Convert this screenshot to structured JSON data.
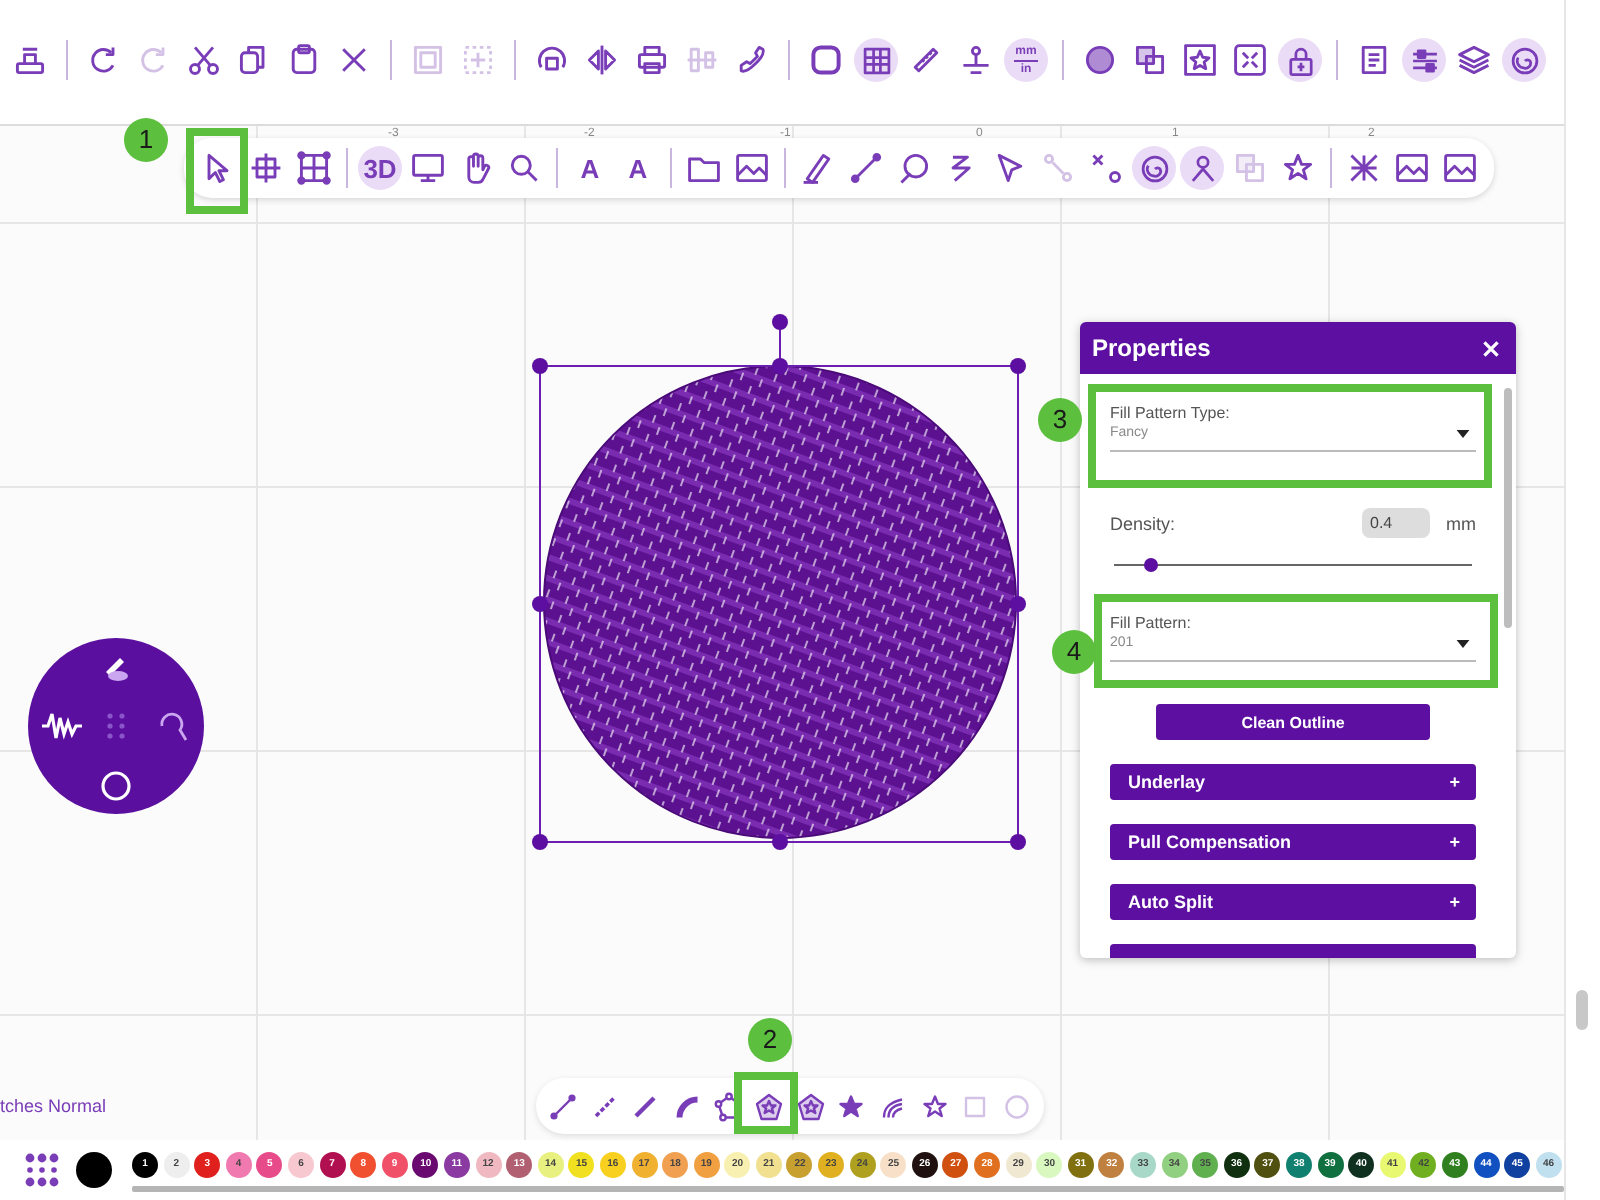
{
  "top_toolbar": [
    [
      {
        "kind": "stamp",
        "highlighted": false,
        "disabled": false
      }
    ],
    [
      {
        "kind": "redo",
        "highlighted": false,
        "disabled": false
      },
      {
        "kind": "redo",
        "highlighted": false,
        "disabled": true
      },
      {
        "kind": "scissors",
        "highlighted": false,
        "disabled": false
      },
      {
        "kind": "copy",
        "highlighted": false,
        "disabled": false
      },
      {
        "kind": "paste",
        "highlighted": false,
        "disabled": false
      },
      {
        "kind": "cross",
        "highlighted": false,
        "disabled": false
      }
    ],
    [
      {
        "kind": "frame",
        "highlighted": false,
        "disabled": true
      },
      {
        "kind": "dashedframe",
        "highlighted": false,
        "disabled": true
      }
    ],
    [
      {
        "kind": "rotate",
        "highlighted": false,
        "disabled": false
      },
      {
        "kind": "mirror",
        "highlighted": false,
        "disabled": false
      },
      {
        "kind": "printer",
        "highlighted": false,
        "disabled": false
      },
      {
        "kind": "align",
        "highlighted": false,
        "disabled": true
      },
      {
        "kind": "phone",
        "highlighted": false,
        "disabled": false
      }
    ],
    [
      {
        "kind": "roundsquare",
        "highlighted": false,
        "disabled": false
      },
      {
        "kind": "grid",
        "highlighted": true,
        "disabled": false
      },
      {
        "kind": "ruler",
        "highlighted": false,
        "disabled": false
      },
      {
        "kind": "pin",
        "highlighted": false,
        "disabled": false
      },
      {
        "kind": "units",
        "label": "mm",
        "sublabel": "in",
        "highlighted": true,
        "disabled": false
      }
    ],
    [
      {
        "kind": "circle",
        "highlighted": false,
        "disabled": false
      },
      {
        "kind": "overlap",
        "highlighted": false,
        "disabled": false
      },
      {
        "kind": "starframe",
        "highlighted": false,
        "disabled": false
      },
      {
        "kind": "expand",
        "highlighted": false,
        "disabled": false
      },
      {
        "kind": "lock",
        "highlighted": true,
        "disabled": false
      }
    ],
    [
      {
        "kind": "document",
        "highlighted": false,
        "disabled": false
      },
      {
        "kind": "sliders",
        "highlighted": true,
        "disabled": false
      },
      {
        "kind": "layers",
        "highlighted": false,
        "disabled": false
      },
      {
        "kind": "spiral",
        "highlighted": true,
        "disabled": false
      }
    ]
  ],
  "ruler_labels": [
    "-3",
    "-2",
    "-1",
    "0",
    "1",
    "2"
  ],
  "tool_toolbar": [
    [
      {
        "kind": "cursor",
        "highlighted": false,
        "disabled": false
      },
      {
        "kind": "crossframe",
        "highlighted": false,
        "disabled": false
      },
      {
        "kind": "gridframe",
        "highlighted": false,
        "disabled": false
      }
    ],
    [
      {
        "kind": "text",
        "label": "3D",
        "highlighted": true,
        "disabled": false
      },
      {
        "kind": "monitor",
        "highlighted": false,
        "disabled": false
      },
      {
        "kind": "hand",
        "highlighted": false,
        "disabled": false
      },
      {
        "kind": "search",
        "highlighted": false,
        "disabled": false
      }
    ],
    [
      {
        "kind": "text",
        "label": "A",
        "highlighted": false,
        "disabled": false
      },
      {
        "kind": "text",
        "label": "A",
        "highlighted": false,
        "disabled": false
      }
    ],
    [
      {
        "kind": "folder",
        "highlighted": false,
        "disabled": false
      },
      {
        "kind": "image",
        "highlighted": false,
        "disabled": false
      }
    ],
    [
      {
        "kind": "pen",
        "highlighted": false,
        "disabled": false
      },
      {
        "kind": "line",
        "highlighted": false,
        "disabled": false
      },
      {
        "kind": "circlepen",
        "highlighted": false,
        "disabled": false
      },
      {
        "kind": "zigzag",
        "highlighted": false,
        "disabled": false
      },
      {
        "kind": "pointer",
        "highlighted": false,
        "disabled": false
      },
      {
        "kind": "nodes",
        "highlighted": false,
        "disabled": true
      },
      {
        "kind": "crossnode",
        "highlighted": false,
        "disabled": false
      },
      {
        "kind": "spiral",
        "highlighted": true,
        "disabled": false
      },
      {
        "kind": "person",
        "highlighted": true,
        "disabled": false
      },
      {
        "kind": "overlap",
        "highlighted": false,
        "disabled": true
      },
      {
        "kind": "star",
        "highlighted": false,
        "disabled": false
      }
    ],
    [
      {
        "kind": "burst",
        "highlighted": false,
        "disabled": false
      },
      {
        "kind": "image",
        "highlighted": false,
        "disabled": false
      },
      {
        "kind": "image",
        "highlighted": false,
        "disabled": false
      }
    ]
  ],
  "properties": {
    "title": "Properties",
    "fill_pattern_type": {
      "label": "Fill Pattern Type:",
      "value": "Fancy"
    },
    "density": {
      "label": "Density:",
      "value": "0.4",
      "unit": "mm",
      "level": 0.1
    },
    "fill_pattern": {
      "label": "Fill Pattern:",
      "value": "201"
    },
    "clean_button": "Clean Outline",
    "sections": [
      {
        "title": "Underlay",
        "toggle": "+"
      },
      {
        "title": "Pull Compensation",
        "toggle": "+"
      },
      {
        "title": "Auto Split",
        "toggle": "+"
      }
    ],
    "more_sections_below": true
  },
  "status_text": "tches Normal",
  "shape_toolbar": [
    {
      "kind": "line",
      "disabled": false
    },
    {
      "kind": "dashline",
      "disabled": false
    },
    {
      "kind": "thickline",
      "disabled": false
    },
    {
      "kind": "arc",
      "disabled": false
    },
    {
      "kind": "nodeshape",
      "disabled": false
    },
    {
      "kind": "pentastar",
      "disabled": false
    },
    {
      "kind": "pentastar",
      "disabled": false
    },
    {
      "kind": "starfilled",
      "disabled": false
    },
    {
      "kind": "curves",
      "disabled": false
    },
    {
      "kind": "star",
      "disabled": false
    },
    {
      "kind": "square",
      "disabled": true
    },
    {
      "kind": "circleout",
      "disabled": true
    }
  ],
  "palette": {
    "current": {
      "color": "#000000"
    },
    "swatches": [
      {
        "label": "1",
        "color": "#000000"
      },
      {
        "label": "2",
        "color": "#eeeeee"
      },
      {
        "label": "3",
        "color": "#e0201c"
      },
      {
        "label": "4",
        "color": "#f07ab0"
      },
      {
        "label": "5",
        "color": "#e84b8a"
      },
      {
        "label": "6",
        "color": "#f8c8d0"
      },
      {
        "label": "7",
        "color": "#b01050"
      },
      {
        "label": "8",
        "color": "#f05030"
      },
      {
        "label": "9",
        "color": "#f05068"
      },
      {
        "label": "10",
        "color": "#6a0a70"
      },
      {
        "label": "11",
        "color": "#8a3aa0"
      },
      {
        "label": "12",
        "color": "#f0b8c0"
      },
      {
        "label": "13",
        "color": "#b06070"
      },
      {
        "label": "14",
        "color": "#e8f080"
      },
      {
        "label": "15",
        "color": "#f0e020"
      },
      {
        "label": "16",
        "color": "#f8d020"
      },
      {
        "label": "17",
        "color": "#f0b030"
      },
      {
        "label": "18",
        "color": "#f0a050"
      },
      {
        "label": "19",
        "color": "#f0a040"
      },
      {
        "label": "20",
        "color": "#f8f0b0"
      },
      {
        "label": "21",
        "color": "#f0e090"
      },
      {
        "label": "22",
        "color": "#c8a030"
      },
      {
        "label": "23",
        "color": "#e0b020"
      },
      {
        "label": "24",
        "color": "#b0a020"
      },
      {
        "label": "25",
        "color": "#f8e0c8"
      },
      {
        "label": "26",
        "color": "#201010"
      },
      {
        "label": "27",
        "color": "#d05010"
      },
      {
        "label": "28",
        "color": "#e07020"
      },
      {
        "label": "29",
        "color": "#f0e8d0"
      },
      {
        "label": "30",
        "color": "#d8f8c0"
      },
      {
        "label": "31",
        "color": "#807010"
      },
      {
        "label": "32",
        "color": "#c08040"
      },
      {
        "label": "33",
        "color": "#a8d8c8"
      },
      {
        "label": "34",
        "color": "#90d080"
      },
      {
        "label": "35",
        "color": "#60b050"
      },
      {
        "label": "36",
        "color": "#103010"
      },
      {
        "label": "37",
        "color": "#505010"
      },
      {
        "label": "38",
        "color": "#108070"
      },
      {
        "label": "39",
        "color": "#107040"
      },
      {
        "label": "40",
        "color": "#103020"
      },
      {
        "label": "41",
        "color": "#e8f870"
      },
      {
        "label": "42",
        "color": "#70b020"
      },
      {
        "label": "43",
        "color": "#308020"
      },
      {
        "label": "44",
        "color": "#1050c0"
      },
      {
        "label": "45",
        "color": "#1040a0"
      },
      {
        "label": "46",
        "color": "#c0e0f0"
      }
    ]
  },
  "callouts": [
    {
      "number": "1"
    },
    {
      "number": "2"
    },
    {
      "number": "3"
    },
    {
      "number": "4"
    }
  ]
}
